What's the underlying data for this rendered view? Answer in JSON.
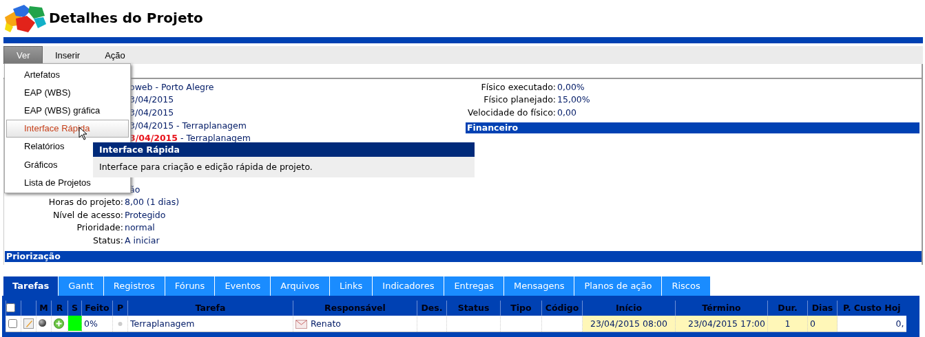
{
  "header": {
    "title": "Detalhes do Projeto"
  },
  "menu_bar": [
    {
      "label": "Ver",
      "selected": true
    },
    {
      "label": "Inserir",
      "selected": false
    },
    {
      "label": "Ação",
      "selected": false
    }
  ],
  "dropdown": [
    {
      "label": "Artefatos",
      "selected": false
    },
    {
      "label": "EAP (WBS)",
      "selected": false
    },
    {
      "label": "EAP (WBS) gráfica",
      "selected": false
    },
    {
      "label": "Interface Rápida",
      "selected": true
    },
    {
      "label": "Relatórios",
      "selected": false
    },
    {
      "label": "Gráficos",
      "selected": false
    },
    {
      "label": "Lista de Projetos",
      "selected": false
    }
  ],
  "tooltip": {
    "title": "Interface Rápida",
    "text": "Interface para criação e edição rápida de projeto."
  },
  "details_left": [
    {
      "kind": "partial",
      "value": "oweb - Porto Alegre"
    },
    {
      "kind": "partial",
      "value": "3/04/2015"
    },
    {
      "kind": "partial",
      "value": "3/04/2015"
    },
    {
      "kind": "partial",
      "value": "3/04/2015 - Terraplanagem"
    },
    {
      "kind": "partial",
      "value": "3/04/2015",
      "suffix": " - Terraplanagem",
      "late": true
    },
    {
      "kind": "hidden"
    },
    {
      "kind": "hidden"
    },
    {
      "kind": "hidden"
    },
    {
      "kind": "partial",
      "value": "ão"
    },
    {
      "kind": "full",
      "label": "Horas do projeto:",
      "value": "8,00 (1 dias)"
    },
    {
      "kind": "full",
      "label": "Nível de acesso:",
      "value": "Protegido"
    },
    {
      "kind": "full",
      "label": "Prioridade:",
      "value": "normal"
    },
    {
      "kind": "full",
      "label": "Status:",
      "value": "A iniciar"
    }
  ],
  "details_right": [
    {
      "label": "Físico executado:",
      "value": "0,00%"
    },
    {
      "label": "Físico planejado:",
      "value": "15,00%"
    },
    {
      "label": "Velocidade do físico:",
      "value": "0,00"
    }
  ],
  "right_section": "Financeiro",
  "bottom_section": "Priorização",
  "tabs": [
    {
      "label": "Tarefas",
      "selected": true
    },
    {
      "label": "Gantt",
      "selected": false
    },
    {
      "label": "Registros",
      "selected": false
    },
    {
      "label": "Fóruns",
      "selected": false
    },
    {
      "label": "Eventos",
      "selected": false
    },
    {
      "label": "Arquivos",
      "selected": false
    },
    {
      "label": "Links",
      "selected": false
    },
    {
      "label": "Indicadores",
      "selected": false
    },
    {
      "label": "Entregas",
      "selected": false
    },
    {
      "label": "Mensagens",
      "selected": false
    },
    {
      "label": "Planos de ação",
      "selected": false
    },
    {
      "label": "Riscos",
      "selected": false
    }
  ],
  "table": {
    "header_checked": false,
    "columns": [
      "",
      "M",
      "R",
      "S",
      "Feito",
      "P",
      "Tarefa",
      "Responsável",
      "Des.",
      "Status",
      "Tipo",
      "Código",
      "Início",
      "Término",
      "Dur.",
      "Dias",
      "P. Custo Hoj"
    ],
    "rows": [
      {
        "checked": false,
        "cells": [
          {
            "kind": "edit"
          },
          {
            "kind": "marker"
          },
          {
            "kind": "add"
          },
          {
            "kind": "status",
            "color": "#00ff00"
          },
          {
            "kind": "text",
            "text": "0%",
            "highlighted": false
          },
          {
            "kind": "dot"
          },
          {
            "kind": "text",
            "text": "Terraplanagem",
            "highlighted": false
          },
          {
            "kind": "person",
            "text": "Renato"
          },
          {
            "kind": "empty"
          },
          {
            "kind": "empty"
          },
          {
            "kind": "empty"
          },
          {
            "kind": "empty"
          },
          {
            "kind": "text",
            "text": "23/04/2015 08:00",
            "highlighted": true
          },
          {
            "kind": "text",
            "text": "23/04/2015 17:00",
            "highlighted": true
          },
          {
            "kind": "text",
            "text": "1",
            "highlighted": true
          },
          {
            "kind": "text",
            "text": "0",
            "highlighted": true
          },
          {
            "kind": "text",
            "text": "0,",
            "highlighted": false
          }
        ]
      }
    ]
  }
}
